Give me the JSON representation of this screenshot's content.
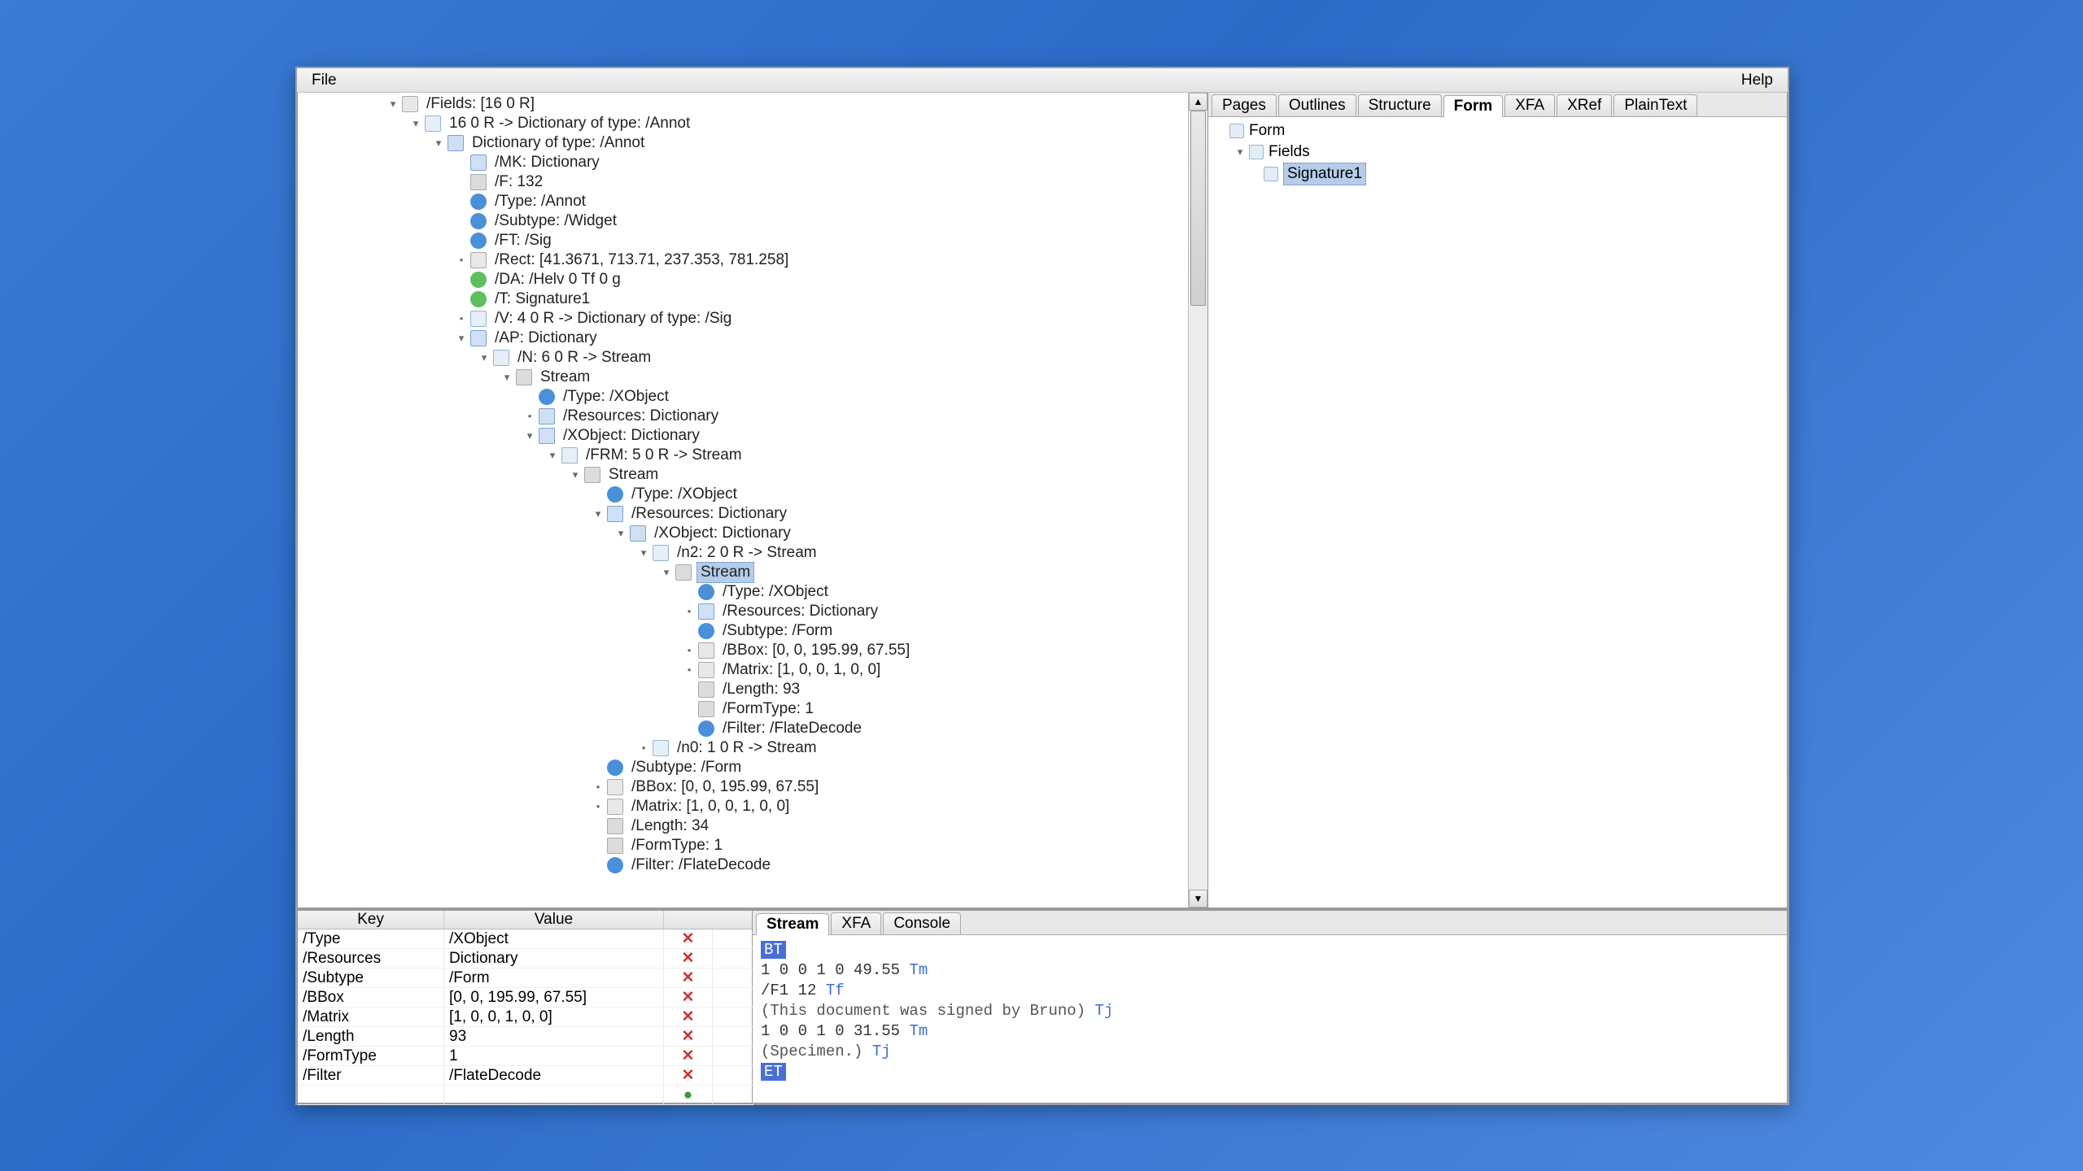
{
  "menu": {
    "file": "File",
    "help": "Help"
  },
  "right_tabs": [
    "Pages",
    "Outlines",
    "Structure",
    "Form",
    "XFA",
    "XRef",
    "PlainText"
  ],
  "right_active": 3,
  "right_tree": {
    "root": "Form",
    "child": "Fields",
    "leaf": "Signature1"
  },
  "bottom_tabs": [
    "Stream",
    "XFA",
    "Console"
  ],
  "bottom_active": 0,
  "kv_header": {
    "key": "Key",
    "value": "Value"
  },
  "kv": [
    {
      "k": "/Type",
      "v": "/XObject"
    },
    {
      "k": "/Resources",
      "v": "Dictionary"
    },
    {
      "k": "/Subtype",
      "v": "/Form"
    },
    {
      "k": "/BBox",
      "v": "[0, 0, 195.99, 67.55]"
    },
    {
      "k": "/Matrix",
      "v": "[1, 0, 0, 1, 0, 0]"
    },
    {
      "k": "/Length",
      "v": "93"
    },
    {
      "k": "/FormType",
      "v": "1"
    },
    {
      "k": "/Filter",
      "v": "/FlateDecode"
    }
  ],
  "stream": {
    "l0_op": "BT",
    "l1": "1 0 0 1 0 49.55 ",
    "l1_cmd": "Tm",
    "l2": "/F1 12 ",
    "l2_cmd": "Tf",
    "l3": "(This document was signed by Bruno) ",
    "l3_cmd": "Tj",
    "l4": "1 0 0 1 0 31.55 ",
    "l4_cmd": "Tm",
    "l5": "(Specimen.) ",
    "l5_cmd": "Tj",
    "l6_op": "ET"
  },
  "tree": [
    {
      "d": 0,
      "h": "▾",
      "ic": "list",
      "t": "/Fields: [16 0 R]"
    },
    {
      "d": 1,
      "h": "▾",
      "ic": "arrow",
      "t": "16 0 R -> Dictionary of type: /Annot"
    },
    {
      "d": 2,
      "h": "▾",
      "ic": "book",
      "t": "Dictionary of type: /Annot"
    },
    {
      "d": 3,
      "h": "",
      "ic": "book",
      "t": "/MK: Dictionary"
    },
    {
      "d": 3,
      "h": "",
      "ic": "pg",
      "t": "/F: 132"
    },
    {
      "d": 3,
      "h": "",
      "ic": "info",
      "t": "/Type: /Annot"
    },
    {
      "d": 3,
      "h": "",
      "ic": "info",
      "t": "/Subtype: /Widget"
    },
    {
      "d": 3,
      "h": "",
      "ic": "info",
      "t": "/FT: /Sig"
    },
    {
      "d": 3,
      "h": "•",
      "ic": "list",
      "t": "/Rect: [41.3671, 713.71, 237.353, 781.258]"
    },
    {
      "d": 3,
      "h": "",
      "ic": "str",
      "t": "/DA: /Helv 0 Tf 0 g"
    },
    {
      "d": 3,
      "h": "",
      "ic": "str",
      "t": "/T: Signature1"
    },
    {
      "d": 3,
      "h": "•",
      "ic": "arrow",
      "t": "/V: 4 0 R -> Dictionary of type: /Sig"
    },
    {
      "d": 3,
      "h": "▾",
      "ic": "book",
      "t": "/AP: Dictionary"
    },
    {
      "d": 4,
      "h": "▾",
      "ic": "arrow",
      "t": "/N: 6 0 R -> Stream"
    },
    {
      "d": 5,
      "h": "▾",
      "ic": "pg",
      "t": "Stream"
    },
    {
      "d": 6,
      "h": "",
      "ic": "info",
      "t": "/Type: /XObject"
    },
    {
      "d": 6,
      "h": "•",
      "ic": "book",
      "t": "/Resources: Dictionary"
    },
    {
      "d": 6,
      "h": "▾",
      "ic": "book",
      "t": "/XObject: Dictionary"
    },
    {
      "d": 7,
      "h": "▾",
      "ic": "arrow",
      "t": "/FRM: 5 0 R -> Stream"
    },
    {
      "d": 8,
      "h": "▾",
      "ic": "pg",
      "t": "Stream"
    },
    {
      "d": 9,
      "h": "",
      "ic": "info",
      "t": "/Type: /XObject"
    },
    {
      "d": 9,
      "h": "▾",
      "ic": "book",
      "t": "/Resources: Dictionary"
    },
    {
      "d": 10,
      "h": "▾",
      "ic": "book",
      "t": "/XObject: Dictionary"
    },
    {
      "d": 11,
      "h": "▾",
      "ic": "arrow",
      "t": "/n2: 2 0 R -> Stream"
    },
    {
      "d": 12,
      "h": "▾",
      "ic": "pg",
      "t": "Stream",
      "sel": true
    },
    {
      "d": 13,
      "h": "",
      "ic": "info",
      "t": "/Type: /XObject"
    },
    {
      "d": 13,
      "h": "•",
      "ic": "book",
      "t": "/Resources: Dictionary"
    },
    {
      "d": 13,
      "h": "",
      "ic": "info",
      "t": "/Subtype: /Form"
    },
    {
      "d": 13,
      "h": "•",
      "ic": "list",
      "t": "/BBox: [0, 0, 195.99, 67.55]"
    },
    {
      "d": 13,
      "h": "•",
      "ic": "list",
      "t": "/Matrix: [1, 0, 0, 1, 0, 0]"
    },
    {
      "d": 13,
      "h": "",
      "ic": "pg",
      "t": "/Length: 93"
    },
    {
      "d": 13,
      "h": "",
      "ic": "pg",
      "t": "/FormType: 1"
    },
    {
      "d": 13,
      "h": "",
      "ic": "info",
      "t": "/Filter: /FlateDecode"
    },
    {
      "d": 11,
      "h": "•",
      "ic": "arrow",
      "t": "/n0: 1 0 R -> Stream"
    },
    {
      "d": 9,
      "h": "",
      "ic": "info",
      "t": "/Subtype: /Form"
    },
    {
      "d": 9,
      "h": "•",
      "ic": "list",
      "t": "/BBox: [0, 0, 195.99, 67.55]"
    },
    {
      "d": 9,
      "h": "•",
      "ic": "list",
      "t": "/Matrix: [1, 0, 0, 1, 0, 0]"
    },
    {
      "d": 9,
      "h": "",
      "ic": "pg",
      "t": "/Length: 34"
    },
    {
      "d": 9,
      "h": "",
      "ic": "pg",
      "t": "/FormType: 1"
    },
    {
      "d": 9,
      "h": "",
      "ic": "info",
      "t": "/Filter: /FlateDecode"
    }
  ]
}
